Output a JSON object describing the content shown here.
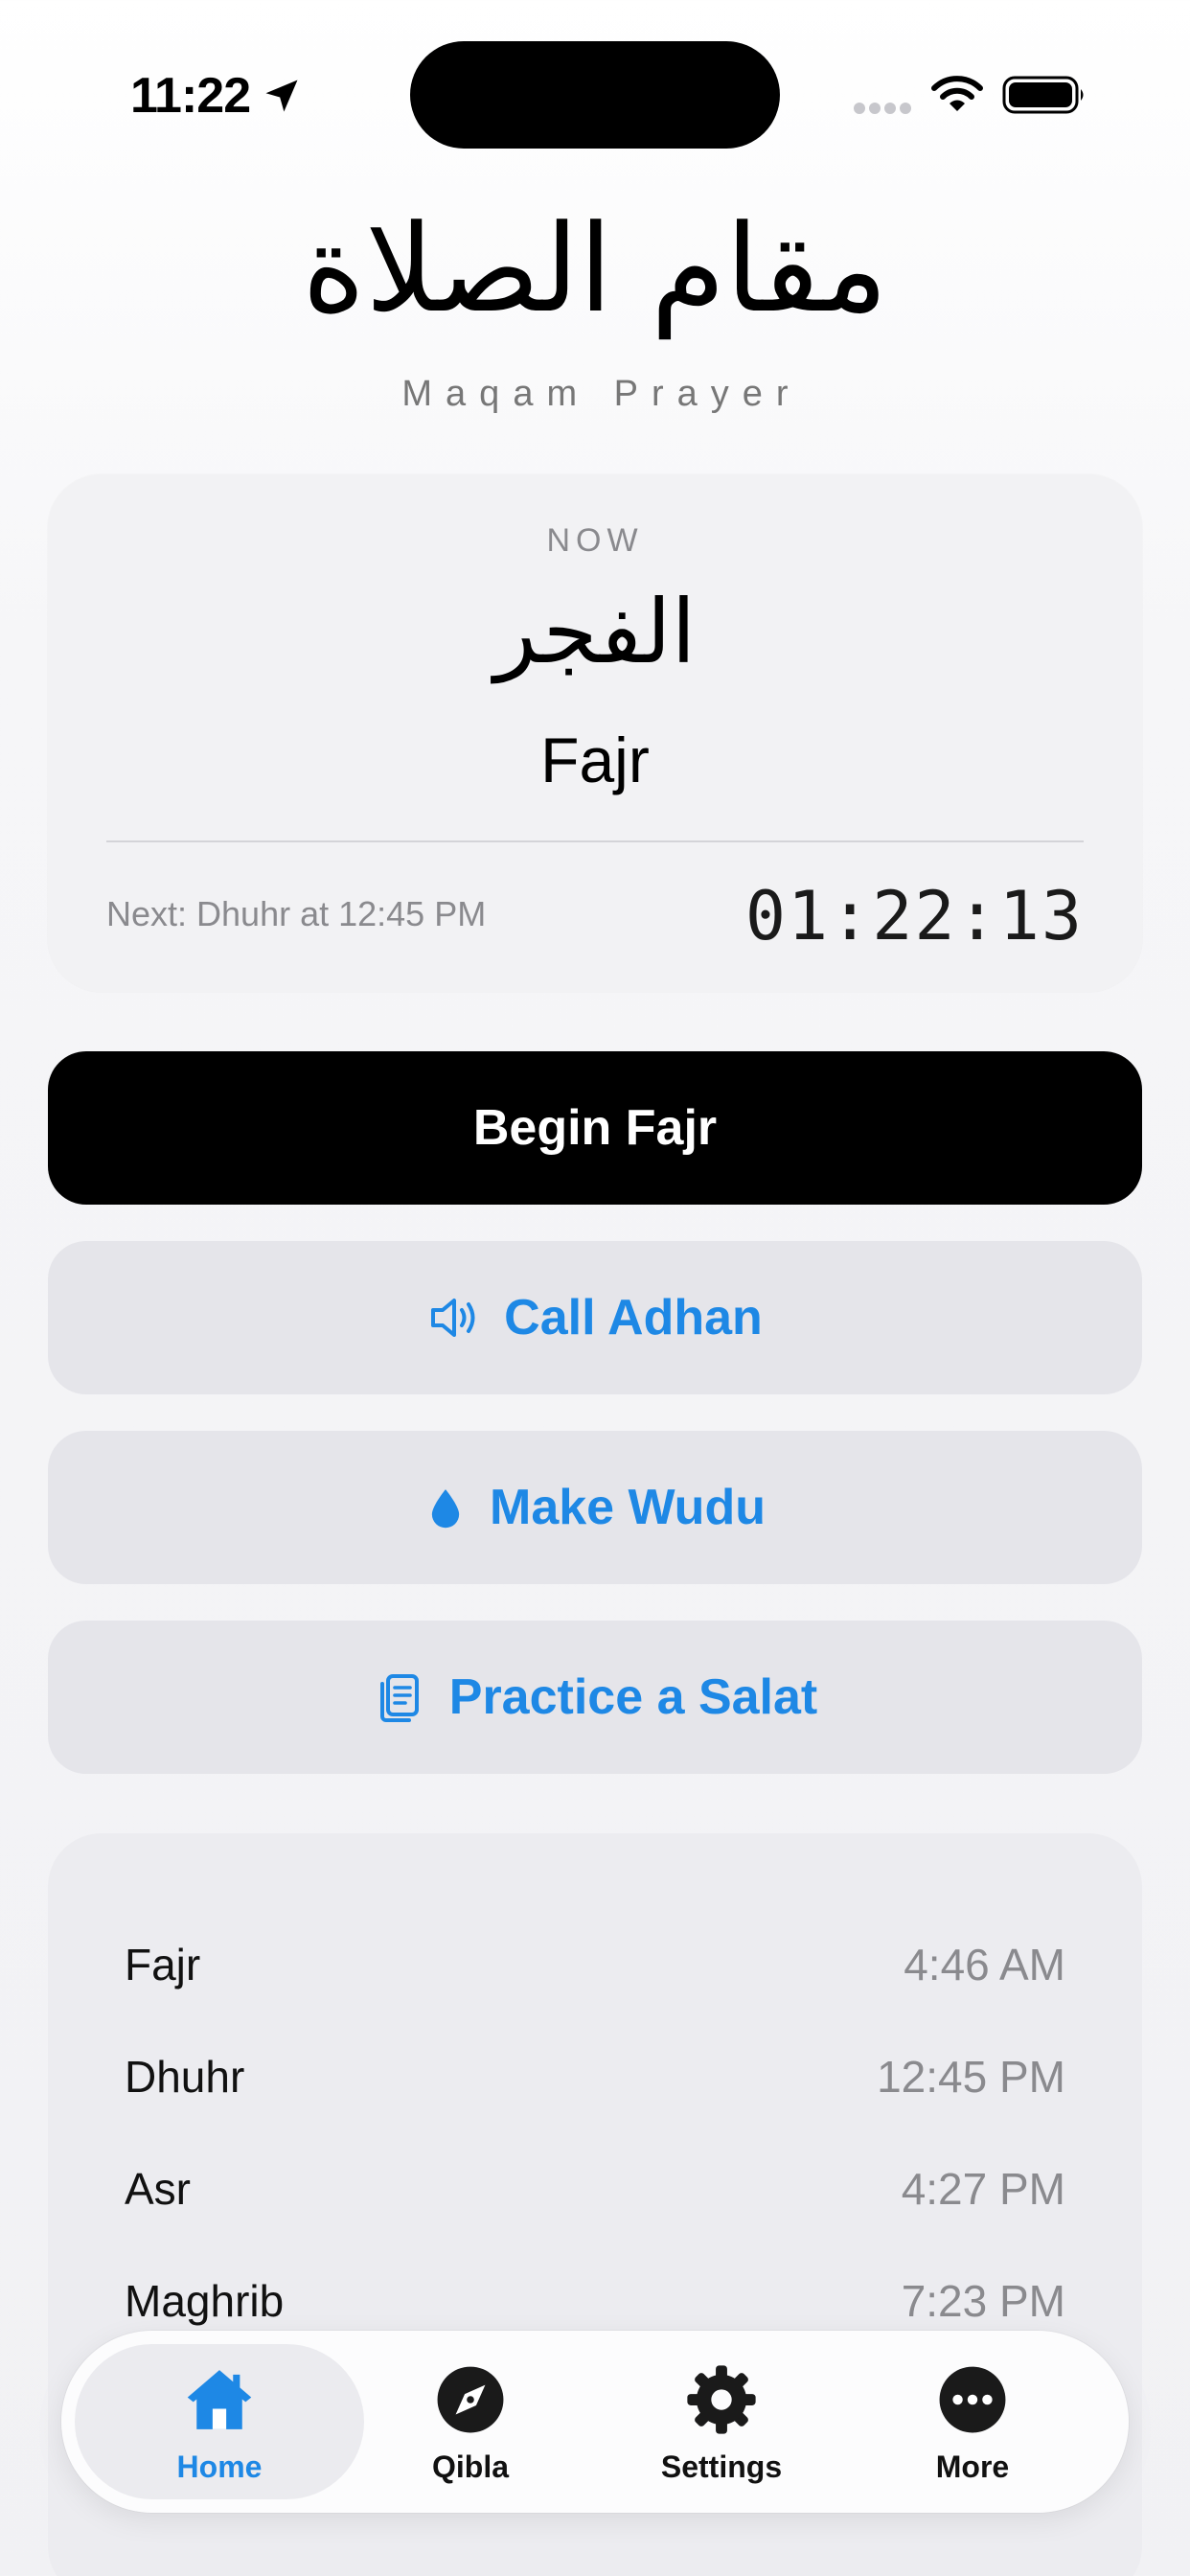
{
  "status_bar": {
    "time": "11:22"
  },
  "header": {
    "title_ar": "مقام الصلاة",
    "title_en": "Maqam Prayer"
  },
  "now_card": {
    "label": "NOW",
    "prayer_ar": "الفجر",
    "prayer_en": "Fajr",
    "next_text": "Next: Dhuhr at 12:45 PM",
    "countdown": "01:22:13"
  },
  "actions": {
    "begin_label": "Begin Fajr",
    "adhan_label": "Call Adhan",
    "wudu_label": "Make Wudu",
    "salat_label": "Practice a Salat"
  },
  "prayer_times": [
    {
      "name": "Fajr",
      "time": "4:46 AM"
    },
    {
      "name": "Dhuhr",
      "time": "12:45 PM"
    },
    {
      "name": "Asr",
      "time": "4:27 PM"
    },
    {
      "name": "Maghrib",
      "time": "7:23 PM"
    }
  ],
  "tabs": [
    {
      "label": "Home",
      "icon": "house-icon",
      "active": true
    },
    {
      "label": "Qibla",
      "icon": "compass-icon",
      "active": false
    },
    {
      "label": "Settings",
      "icon": "gear-icon",
      "active": false
    },
    {
      "label": "More",
      "icon": "ellipsis-circle-icon",
      "active": false
    }
  ],
  "colors": {
    "accent": "#1e88e5",
    "primary_button": "#000000",
    "secondary_button": "#e5e5ea"
  }
}
